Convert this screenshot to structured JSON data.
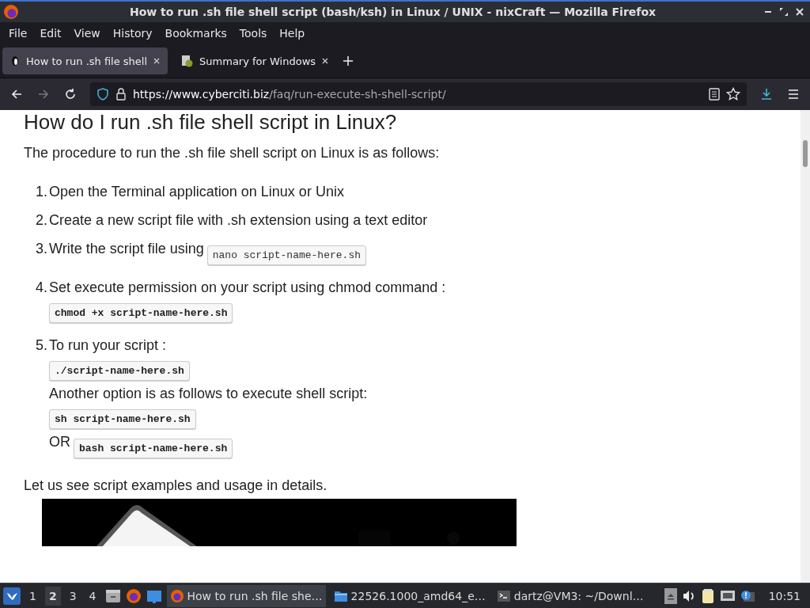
{
  "window": {
    "title": "How to run .sh file shell script (bash/ksh) in Linux / UNIX - nixCraft — Mozilla Firefox"
  },
  "menu": [
    "File",
    "Edit",
    "View",
    "History",
    "Bookmarks",
    "Tools",
    "Help"
  ],
  "tabs": [
    {
      "label": "How to run .sh file shell",
      "selected": true,
      "kind": "penguin"
    },
    {
      "label": "Summary for Windows",
      "selected": false,
      "kind": "doc"
    }
  ],
  "url": {
    "host": "https://www.cyberciti.biz",
    "path": "/faq/run-execute-sh-shell-script/"
  },
  "article": {
    "heading": "How do I run .sh file shell script in Linux?",
    "intro": "The procedure to run the .sh file shell script on Linux is as follows:",
    "steps": [
      {
        "number": "1.",
        "lines": [
          [
            {
              "kind": "text",
              "text": "Open the Terminal application on Linux or Unix"
            }
          ]
        ]
      },
      {
        "number": "2.",
        "lines": [
          [
            {
              "kind": "text",
              "text": "Create a new script file with .sh extension using a text editor"
            }
          ]
        ]
      },
      {
        "number": "3.",
        "lines": [
          [
            {
              "kind": "text",
              "text": "Write the script file using"
            },
            {
              "kind": "code",
              "bold": false,
              "text": "nano script-name-here.sh"
            }
          ]
        ]
      },
      {
        "number": "4.",
        "lines": [
          [
            {
              "kind": "text",
              "text": "Set execute permission on your script using chmod command :"
            }
          ],
          [
            {
              "kind": "code",
              "bold": true,
              "text": "chmod +x script-name-here.sh"
            }
          ]
        ]
      },
      {
        "number": "5.",
        "lines": [
          [
            {
              "kind": "text",
              "text": "To run your script :"
            }
          ],
          [
            {
              "kind": "code",
              "bold": true,
              "text": "./script-name-here.sh"
            }
          ],
          [
            {
              "kind": "text",
              "text": "Another option is as follows to execute shell script:"
            }
          ],
          [
            {
              "kind": "code",
              "bold": true,
              "text": "sh script-name-here.sh"
            }
          ],
          [
            {
              "kind": "text",
              "text": "OR"
            },
            {
              "kind": "code",
              "bold": true,
              "text": "bash script-name-here.sh"
            }
          ]
        ]
      }
    ],
    "outro": "Let us see script examples and usage in details."
  },
  "taskbar": {
    "workspaces": [
      {
        "label": "1",
        "selected": false
      },
      {
        "label": "2",
        "selected": true
      },
      {
        "label": "3",
        "selected": false
      },
      {
        "label": "4",
        "selected": false
      }
    ],
    "tasks": [
      {
        "label": "How to run .sh file she…",
        "kind": "browser",
        "selected": true
      },
      {
        "label": "22526.1000_amd64_e…",
        "kind": "folder",
        "selected": false
      },
      {
        "label": "dartz@VM3: ~/Downl…",
        "kind": "terminal",
        "selected": false
      }
    ],
    "clock": "10:51"
  }
}
